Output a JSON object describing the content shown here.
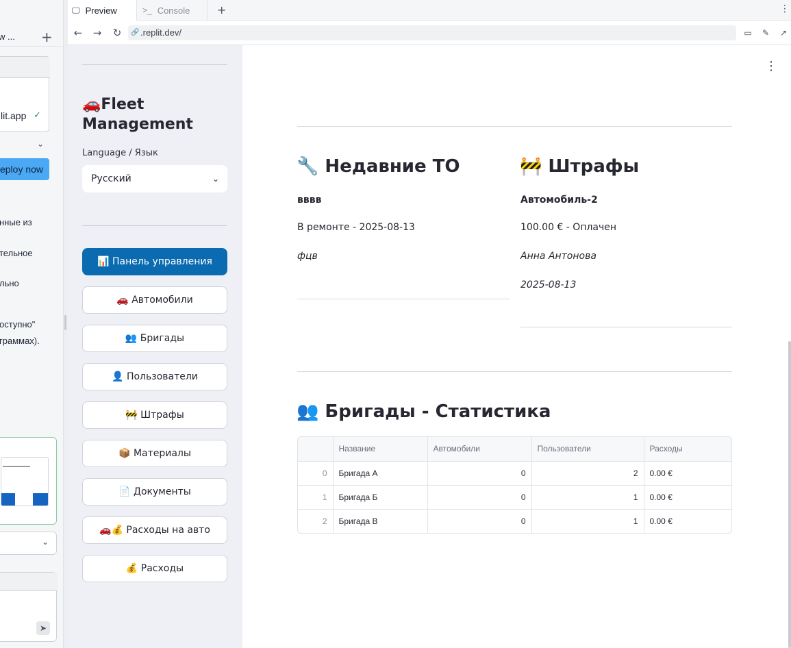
{
  "left_panel": {
    "header_fragment": "w ...",
    "app_url_fragment": "lit.app",
    "deploy_label": "eploy now",
    "text_lines": [
      "нные из",
      "тельное",
      "льно",
      "оступно\"",
      "граммах)."
    ]
  },
  "tabs": [
    {
      "label": "Preview",
      "icon": "monitor-icon"
    },
    {
      "label": "Console",
      "icon": "terminal-icon"
    }
  ],
  "url": ".replit.dev/",
  "sidebar": {
    "title_emoji": "🚗",
    "title": "Fleet Management",
    "language_label": "Language / Язык",
    "language_value": "Русский",
    "nav": [
      {
        "label": "📊 Панель управления",
        "active": true
      },
      {
        "label": "🚗 Автомобили",
        "active": false
      },
      {
        "label": "👥 Бригады",
        "active": false
      },
      {
        "label": "👤 Пользователи",
        "active": false
      },
      {
        "label": "🚧 Штрафы",
        "active": false
      },
      {
        "label": "📦 Материалы",
        "active": false
      },
      {
        "label": "📄 Документы",
        "active": false
      },
      {
        "label": "🚗💰 Расходы на авто",
        "active": false
      },
      {
        "label": "💰 Расходы",
        "active": false
      }
    ]
  },
  "main": {
    "maintenance": {
      "heading": "🔧 Недавние ТО",
      "item_title": "вввв",
      "status": "В ремонте - 2025-08-13",
      "note": "фцв"
    },
    "fines": {
      "heading": "🚧 Штрафы",
      "vehicle": "Автомобиль-2",
      "amount": "100.00 € - Оплачен",
      "person": "Анна Антонова",
      "date": "2025-08-13"
    },
    "teams": {
      "heading": "👥 Бригады - Статистика",
      "columns": [
        "",
        "Название",
        "Автомобили",
        "Пользователи",
        "Расходы"
      ],
      "rows": [
        [
          "0",
          "Бригада А",
          "0",
          "2",
          "0.00 €"
        ],
        [
          "1",
          "Бригада Б",
          "0",
          "1",
          "0.00 €"
        ],
        [
          "2",
          "Бригада В",
          "0",
          "1",
          "0.00 €"
        ]
      ]
    }
  },
  "colors": {
    "primary": "#0b6bb0",
    "sidebar_bg": "#eef0f5"
  }
}
